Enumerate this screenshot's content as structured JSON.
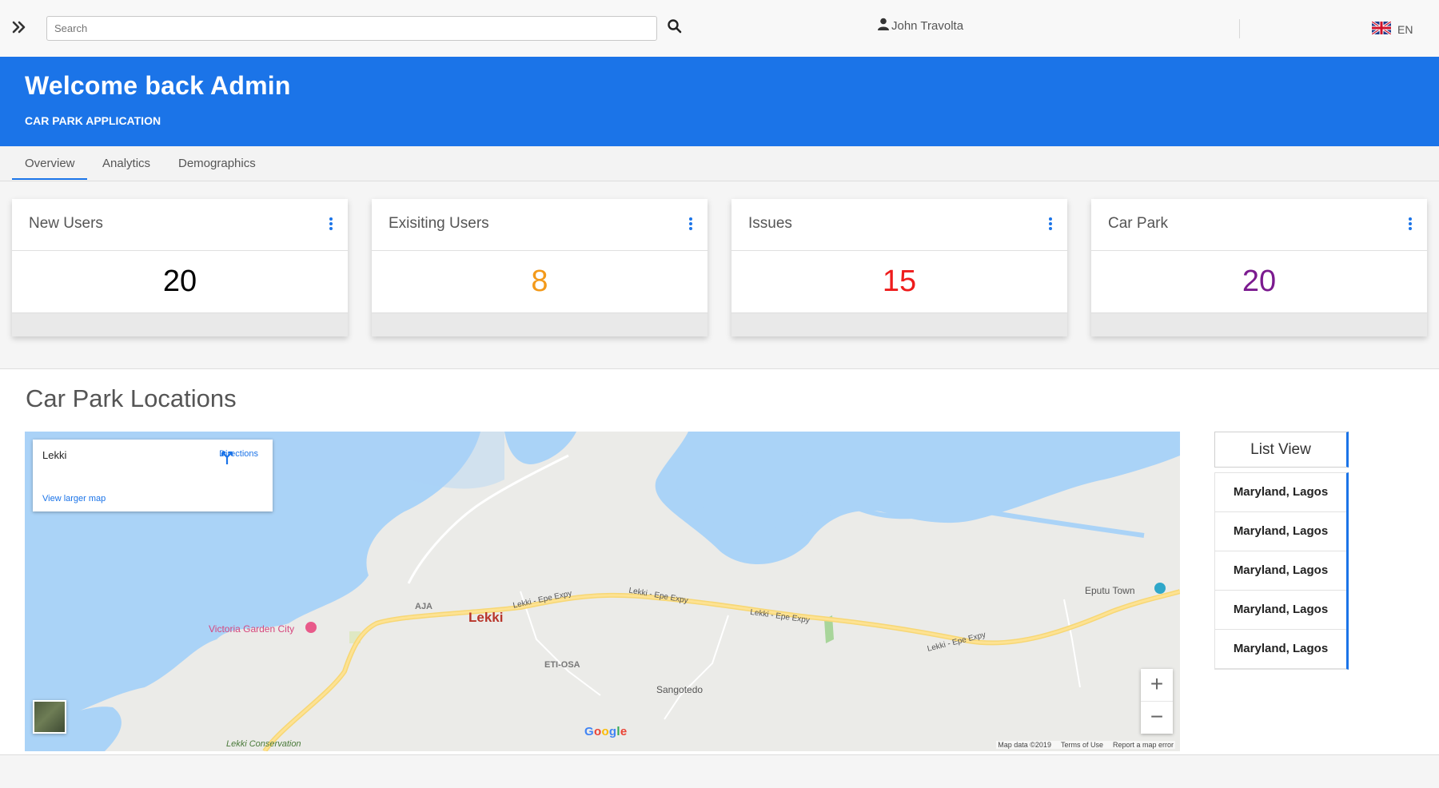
{
  "topbar": {
    "search_placeholder": "Search",
    "user_name": "John Travolta",
    "language": "EN"
  },
  "banner": {
    "title": "Welcome back Admin",
    "subtitle": "CAR PARK APPLICATION",
    "color": "#1b74e8"
  },
  "tabs": [
    {
      "label": "Overview",
      "active": true
    },
    {
      "label": "Analytics",
      "active": false
    },
    {
      "label": "Demographics",
      "active": false
    }
  ],
  "cards": [
    {
      "title": "New Users",
      "value": "20",
      "color": "#000000"
    },
    {
      "title": "Exisiting Users",
      "value": "8",
      "color": "#f39a1b"
    },
    {
      "title": "Issues",
      "value": "15",
      "color": "#ee1c1c"
    },
    {
      "title": "Car Park",
      "value": "20",
      "color": "#7b1a8f"
    }
  ],
  "locations": {
    "title": "Car Park Locations",
    "map": {
      "place": "Lekki",
      "directions": "Directions",
      "view_larger": "View larger map",
      "labels": {
        "lekki": "Lekki",
        "aja": "AJA",
        "eti_osa": "ETI-OSA",
        "sangotedo": "Sangotedo",
        "victoria": "Victoria Garden City",
        "eputu": "Eputu Town",
        "road1": "Lekki - Epe Expy",
        "road2": "Lekki - Epe Expy",
        "road3": "Lekki - Epe Expy",
        "road4": "Lekki - Epe Expy",
        "conservation": "Lekki Conservation"
      },
      "google": "Google",
      "attribution": {
        "data": "Map data ©2019",
        "terms": "Terms of Use",
        "report": "Report a map error"
      }
    },
    "list_view_label": "List View",
    "items": [
      "Maryland, Lagos",
      "Maryland, Lagos",
      "Maryland, Lagos",
      "Maryland, Lagos",
      "Maryland, Lagos"
    ]
  }
}
